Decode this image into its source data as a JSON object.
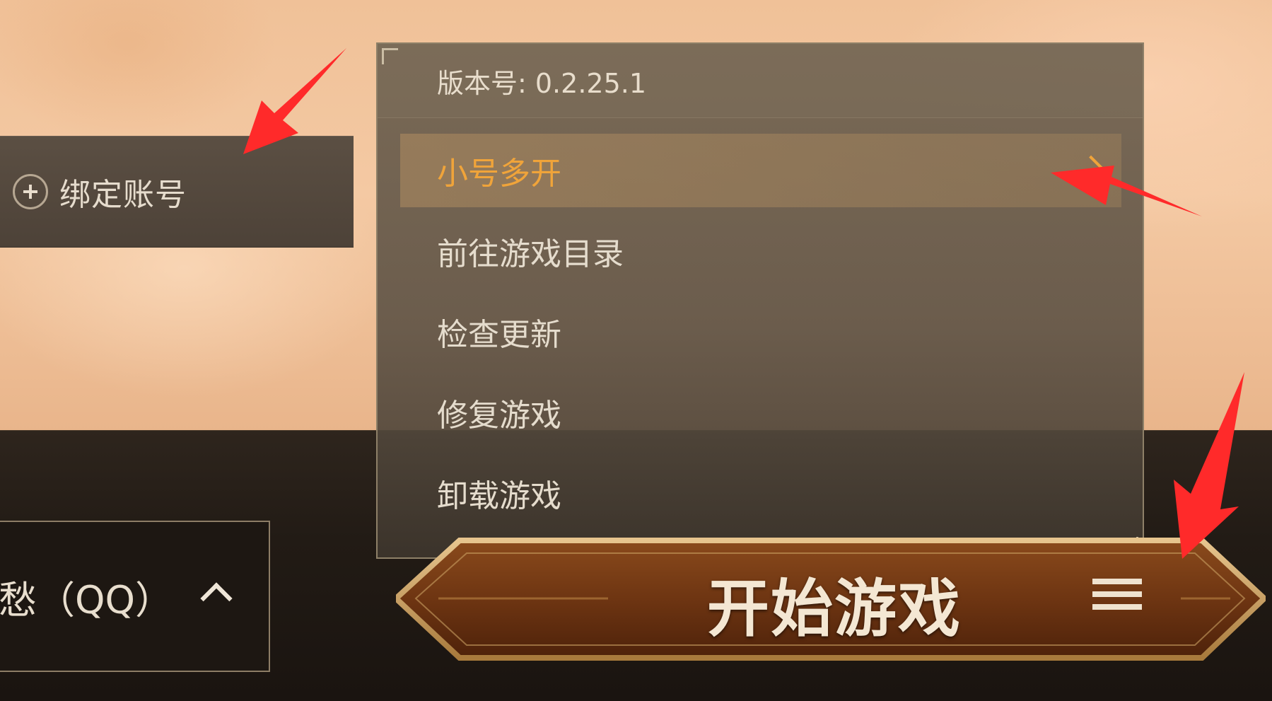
{
  "bind_account": {
    "label": "绑定账号",
    "icon": "plus-circle-icon"
  },
  "menu": {
    "version_text": "版本号: 0.2.25.1",
    "items": [
      {
        "label": "小号多开",
        "active": true,
        "has_submenu": true
      },
      {
        "label": "前往游戏目录"
      },
      {
        "label": "检查更新"
      },
      {
        "label": "修复游戏"
      },
      {
        "label": "卸载游戏"
      }
    ]
  },
  "account_selector": {
    "text": "愁（QQ）",
    "icon": "chevron-up-icon"
  },
  "start_button": {
    "label": "开始游戏",
    "menu_icon": "hamburger-menu-icon"
  },
  "colors": {
    "accent_orange": "#f0a43a",
    "menu_bg": "#706250",
    "annotation_red": "#ff2a2a"
  }
}
